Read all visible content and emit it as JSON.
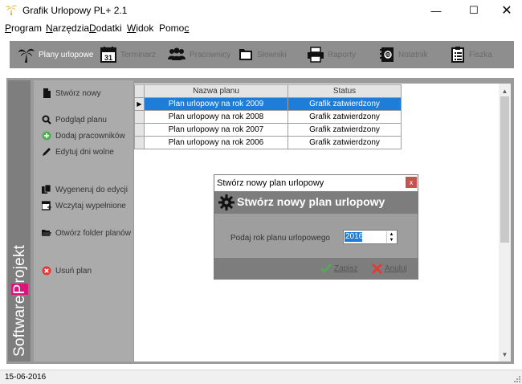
{
  "window": {
    "title": "Grafik Urlopowy PL+ 2.1",
    "minimize": "—",
    "maximize": "☐",
    "close": "✕"
  },
  "menu": [
    {
      "label": "Program",
      "underline": "P"
    },
    {
      "label": "Narzędzia",
      "underline": "N"
    },
    {
      "label": "Dodatki",
      "underline": "D"
    },
    {
      "label": "Widok",
      "underline": "W"
    },
    {
      "label": "Pomoc",
      "underline": "c"
    }
  ],
  "toolbar": {
    "items": [
      {
        "label": "Plany urlopowe",
        "icon": "palm-tree-icon",
        "active": true
      },
      {
        "label": "Terminarz",
        "icon": "calendar-icon",
        "badge": "31"
      },
      {
        "label": "Pracownicy",
        "icon": "people-icon"
      },
      {
        "label": "Słowniki",
        "icon": "folder-icon"
      },
      {
        "label": "Raporty",
        "icon": "printer-icon"
      },
      {
        "label": "Notatnik",
        "icon": "notebook-icon"
      },
      {
        "label": "Fiszka",
        "icon": "checklist-icon"
      }
    ]
  },
  "brand": {
    "pre": "Software",
    "p": "P",
    "post": "rojekt",
    "accent": "#d9177a"
  },
  "sidebar": {
    "items": [
      {
        "label": "Stwórz nowy",
        "icon": "new-document-icon"
      },
      {
        "label": "Podgląd planu",
        "icon": "magnifier-icon"
      },
      {
        "label": "Dodaj pracowników",
        "icon": "add-circle-icon"
      },
      {
        "label": "Edytuj dni wolne",
        "icon": "pencil-icon"
      },
      {
        "label": "Wygeneruj do edycji",
        "icon": "copy-documents-icon"
      },
      {
        "label": "Wczytaj wypełnione",
        "icon": "load-calendar-icon"
      },
      {
        "label": "Otwórz folder planów",
        "icon": "open-folder-icon"
      },
      {
        "label": "Usuń plan",
        "icon": "delete-circle-icon"
      }
    ]
  },
  "table": {
    "columns": [
      "Nazwa planu",
      "Status"
    ],
    "rows": [
      {
        "name": "Plan urlopowy na rok 2009",
        "status": "Grafik zatwierdzony",
        "selected": true,
        "marker": "▶"
      },
      {
        "name": "Plan urlopowy na rok 2008",
        "status": "Grafik zatwierdzony"
      },
      {
        "name": "Plan urlopowy na rok 2007",
        "status": "Grafik zatwierdzony"
      },
      {
        "name": "Plan urlopowy na rok 2006",
        "status": "Grafik zatwierdzony"
      }
    ]
  },
  "dialog": {
    "title": "Stwórz nowy plan urlopowy",
    "close": "x",
    "header": "Stwórz nowy plan urlopowy",
    "label": "Podaj rok planu urlopowego",
    "year": "2016",
    "ok": "Zapisz",
    "cancel": "Anuluj"
  },
  "status": {
    "date": "15-06-2016"
  },
  "colors": {
    "selection": "#1e7dd8",
    "toolbar": "#8e8e8e",
    "sidebar": "#ababab"
  }
}
